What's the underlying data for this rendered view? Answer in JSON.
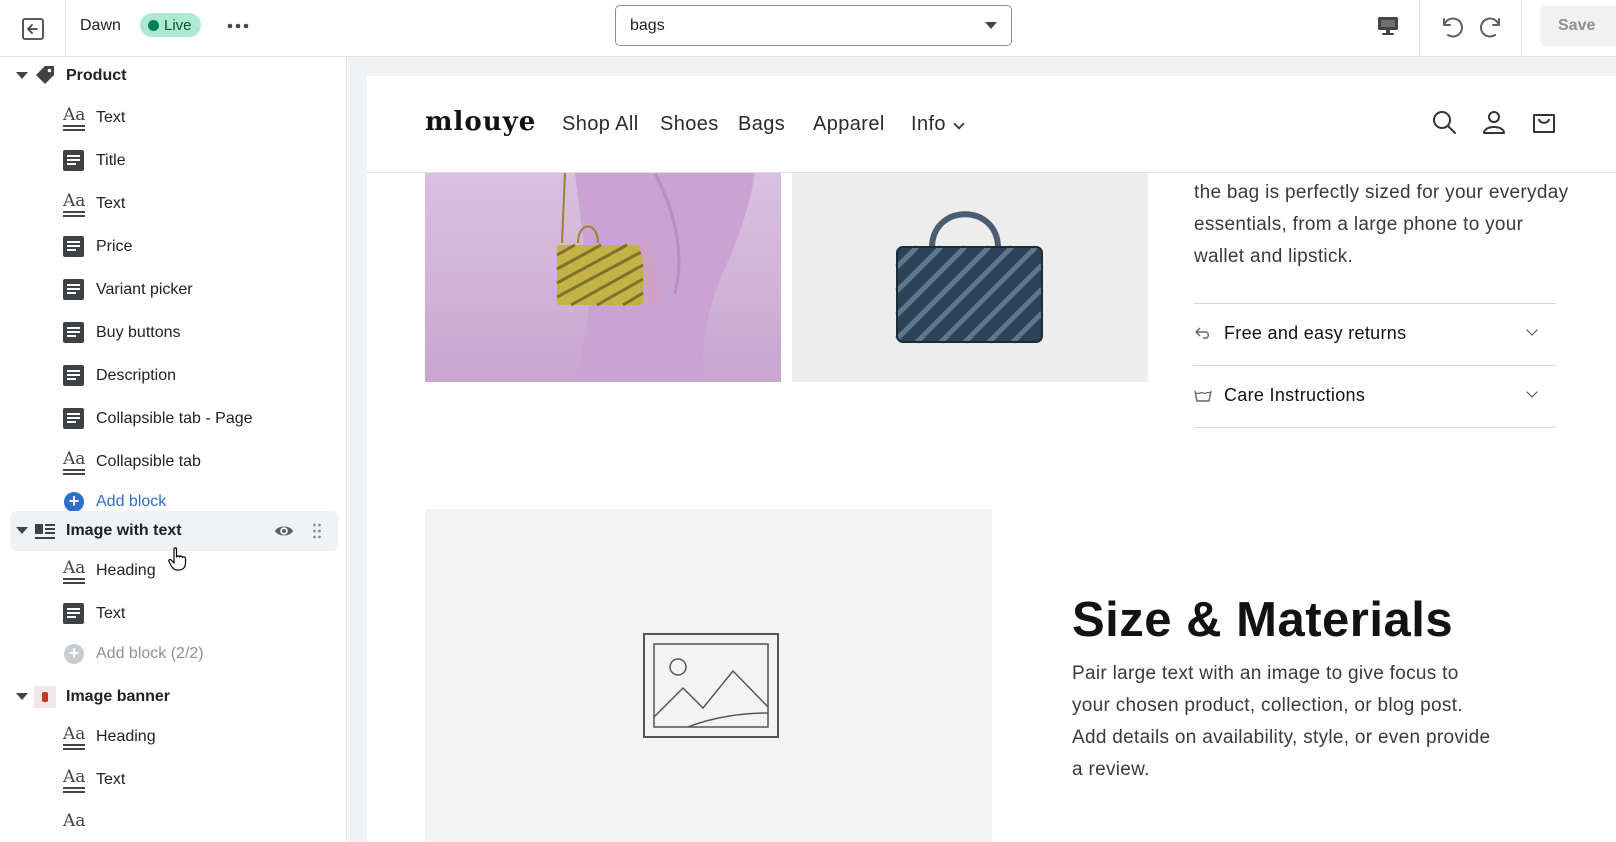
{
  "topbar": {
    "theme_name": "Dawn",
    "status_badge": "Live",
    "page_selector_value": "bags",
    "save_label": "Save"
  },
  "sidebar": {
    "product_section": {
      "label": "Product",
      "blocks": [
        {
          "label": "Text",
          "icon": "text-icon"
        },
        {
          "label": "Title",
          "icon": "block-icon"
        },
        {
          "label": "Text",
          "icon": "text-icon"
        },
        {
          "label": "Price",
          "icon": "block-icon"
        },
        {
          "label": "Variant picker",
          "icon": "block-icon"
        },
        {
          "label": "Buy buttons",
          "icon": "block-icon"
        },
        {
          "label": "Description",
          "icon": "block-icon"
        },
        {
          "label": "Collapsible tab - Page",
          "icon": "block-icon"
        },
        {
          "label": "Collapsible tab",
          "icon": "text-icon"
        }
      ],
      "add_block_label": "Add block"
    },
    "image_with_text_section": {
      "label": "Image with text",
      "blocks": [
        {
          "label": "Heading",
          "icon": "text-icon"
        },
        {
          "label": "Text",
          "icon": "block-icon"
        }
      ],
      "add_block_label": "Add block (2/2)"
    },
    "image_banner_section": {
      "label": "Image banner",
      "blocks": [
        {
          "label": "Heading",
          "icon": "text-icon"
        },
        {
          "label": "Text",
          "icon": "text-icon"
        }
      ]
    }
  },
  "preview": {
    "store_logo": "mlouye",
    "nav": [
      "Shop All",
      "Shoes",
      "Bags",
      "Apparel",
      "Info"
    ],
    "product_description": "the bag is perfectly sized for your everyday essentials, from a large phone to your wallet and lipstick.",
    "accordions": [
      {
        "label": "Free and easy returns",
        "icon": "return-arrow-icon"
      },
      {
        "label": "Care Instructions",
        "icon": "wash-basin-icon"
      }
    ],
    "image_with_text": {
      "heading": "Size & Materials",
      "body": "Pair large text with an image to give focus to your chosen product, collection, or blog post. Add details on availability, style, or even provide a review."
    }
  },
  "colors": {
    "live_badge_bg": "#aee9d1",
    "live_dot": "#007f5f",
    "link_blue": "#2c6ecb",
    "selected_row_bg": "#f1f2f3"
  }
}
